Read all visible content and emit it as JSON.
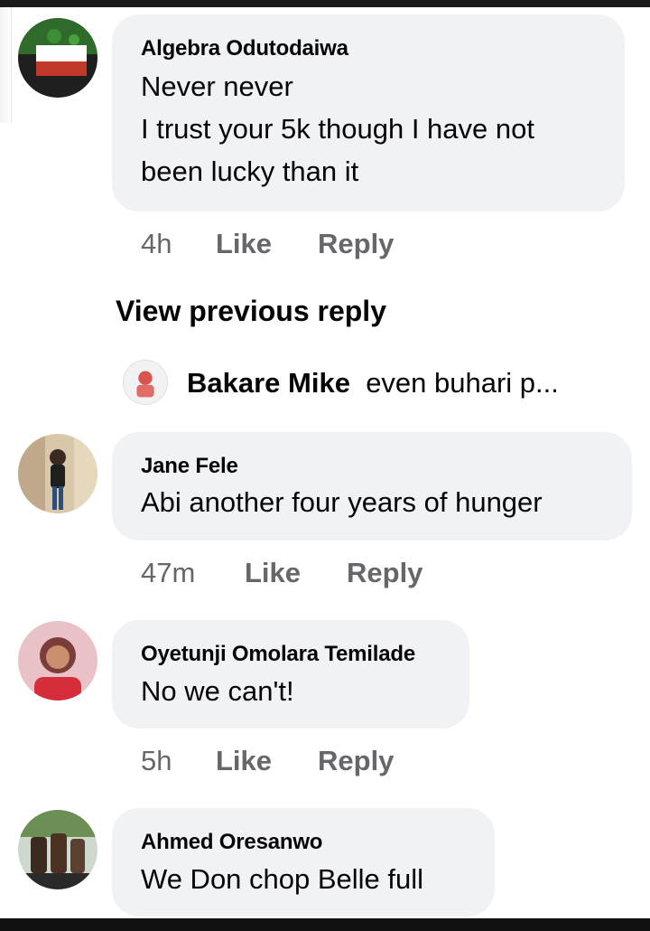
{
  "comments": [
    {
      "author": "Algebra Odutodaiwa",
      "lines": [
        "Never never",
        "I trust your 5k though I have not",
        "been lucky than it"
      ],
      "time": "4h",
      "like": "Like",
      "reply": "Reply",
      "avatar_icon": "flag-avatar"
    },
    {
      "author": "Jane Fele",
      "lines": [
        "Abi another four years of hunger"
      ],
      "time": "47m",
      "like": "Like",
      "reply": "Reply",
      "avatar_icon": "person-photo-avatar"
    },
    {
      "author": "Oyetunji Omolara Temilade",
      "lines": [
        "No we can't!"
      ],
      "time": "5h",
      "like": "Like",
      "reply": "Reply",
      "avatar_icon": "person-photo-avatar"
    },
    {
      "author": "Ahmed Oresanwo",
      "lines": [
        "We Don chop Belle full"
      ],
      "avatar_icon": "drinks-photo-avatar"
    }
  ],
  "view_previous": "View previous reply",
  "reply_preview": {
    "name": "Bakare Mike",
    "text": "even buhari p..."
  }
}
